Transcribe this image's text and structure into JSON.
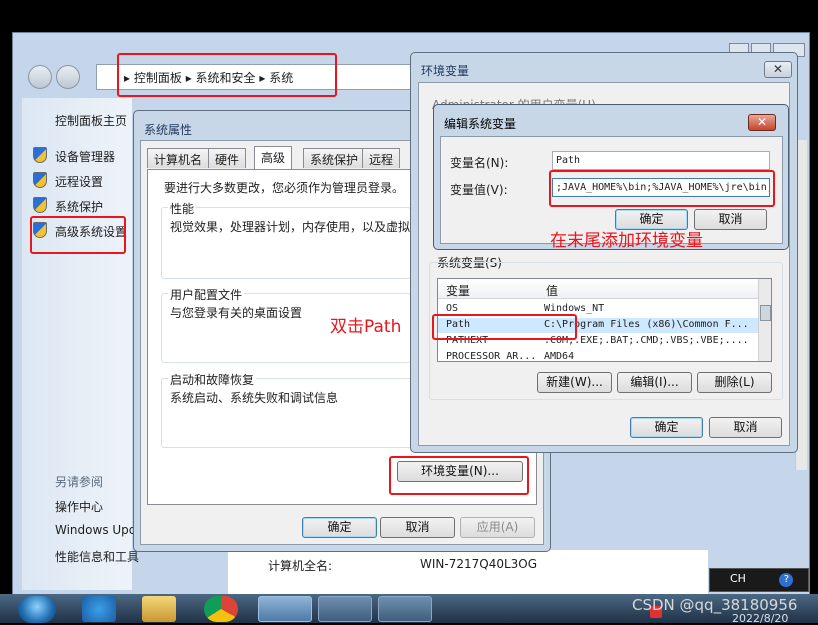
{
  "control_panel": {
    "breadcrumb": [
      "控制面板",
      "系统和安全",
      "系统"
    ],
    "sidebar_home": "控制面板主页",
    "sidebar_items": [
      "设备管理器",
      "远程设置",
      "系统保护",
      "高级系统设置"
    ],
    "see_also_title": "另请参阅",
    "see_also": [
      "操作中心",
      "Windows Update",
      "性能信息和工具"
    ],
    "computer_full_name_label": "计算机全名:",
    "computer_full_name_value": "WIN-7217Q40L3OG"
  },
  "system_properties": {
    "title": "系统属性",
    "tabs": [
      "计算机名",
      "硬件",
      "高级",
      "系统保护",
      "远程"
    ],
    "active_tab": "高级",
    "admin_note": "要进行大多数更改，您必须作为管理员登录。",
    "performance_title": "性能",
    "performance_desc": "视觉效果，处理器计划，内存使用，以及虚拟",
    "profile_title": "用户配置文件",
    "profile_desc": "与您登录有关的桌面设置",
    "startup_title": "启动和故障恢复",
    "startup_desc": "系统启动、系统失败和调试信息",
    "env_button": "环境变量(N)...",
    "ok": "确定",
    "cancel": "取消",
    "apply": "应用(A)"
  },
  "env_vars": {
    "title": "环境变量",
    "user_section_partial": "Administrator 的用户变量(U)",
    "system_section": "系统变量(S)",
    "columns": [
      "变量",
      "值"
    ],
    "rows": [
      {
        "name": "OS",
        "value": "Windows_NT"
      },
      {
        "name": "Path",
        "value": "C:\\Program Files (x86)\\Common F..."
      },
      {
        "name": "PATHEXT",
        "value": ".COM;.EXE;.BAT;.CMD;.VBS;.VBE;...."
      },
      {
        "name": "PROCESSOR_AR...",
        "value": "AMD64"
      }
    ],
    "new_btn": "新建(W)...",
    "edit_btn": "编辑(I)...",
    "delete_btn": "删除(L)",
    "ok": "确定",
    "cancel": "取消"
  },
  "edit_var": {
    "title": "编辑系统变量",
    "name_label": "变量名(N):",
    "name_value": "Path",
    "value_label": "变量值(V):",
    "value_value": ";JAVA_HOME%\\bin;%JAVA_HOME%\\jre\\bin;",
    "ok": "确定",
    "cancel": "取消"
  },
  "annotations": {
    "append_note": "在末尾添加环境变量",
    "double_click_note": "双击Path"
  },
  "taskbar": {
    "lang": "CH",
    "date": "2022/8/20",
    "watermark": "CSDN @qq_38180956"
  },
  "colors": {
    "annotation_red": "#e8161d",
    "dialog_bg": "#f0f0f0",
    "title_text": "#1e395b",
    "selection": "#cde8ff"
  }
}
